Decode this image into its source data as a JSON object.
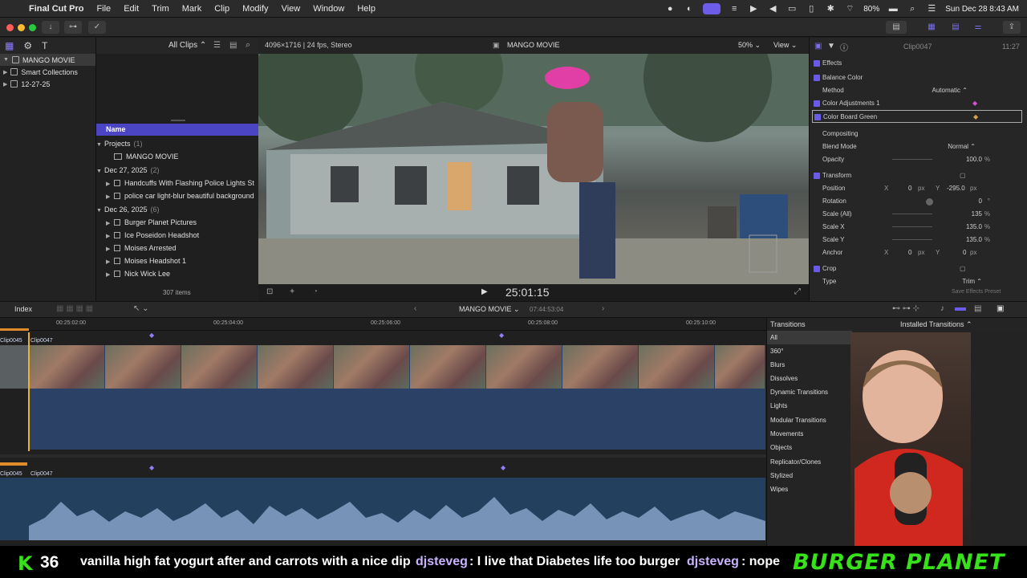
{
  "menubar": {
    "app_name": "Final Cut Pro",
    "items": [
      "File",
      "Edit",
      "Trim",
      "Mark",
      "Clip",
      "Modify",
      "View",
      "Window",
      "Help"
    ],
    "battery": "80%",
    "datetime": "Sun Dec 28  8:43 AM"
  },
  "browser": {
    "filter": "All Clips",
    "format": "4096×1716 | 24 fps, Stereo",
    "libraries": [
      {
        "label": "MANGO MOVIE"
      },
      {
        "label": "Smart Collections"
      },
      {
        "label": "12-27-25"
      }
    ],
    "column_name": "Name",
    "rows": [
      {
        "label": "Projects",
        "count": "(1)",
        "kind": "group"
      },
      {
        "label": "MANGO MOVIE",
        "kind": "project"
      },
      {
        "label": "Dec 27, 2025",
        "count": "(2)",
        "kind": "group"
      },
      {
        "label": "Handcuffs With Flashing Police Lights St",
        "kind": "clip"
      },
      {
        "label": "police car light-blur beautiful background",
        "kind": "clip"
      },
      {
        "label": "Dec 26, 2025",
        "count": "(6)",
        "kind": "group"
      },
      {
        "label": "Burger Planet Pictures",
        "kind": "clip"
      },
      {
        "label": "Ice Poseidon Headshot",
        "kind": "clip"
      },
      {
        "label": "Moises Arrested",
        "kind": "clip"
      },
      {
        "label": "Moises Headshot 1",
        "kind": "clip"
      },
      {
        "label": "Nick Wick Lee",
        "kind": "clip"
      }
    ],
    "item_count": "307 items"
  },
  "viewer": {
    "title": "MANGO MOVIE",
    "zoom": "50%",
    "view_label": "View",
    "timecode": "25:01:15"
  },
  "inspector": {
    "clip_name": "Clip0047",
    "duration": "11:27",
    "effects_label": "Effects",
    "balance_color": "Balance Color",
    "method_label": "Method",
    "method_value": "Automatic",
    "color_adj": "Color Adjustments 1",
    "color_board": "Color Board Green",
    "compositing": "Compositing",
    "blend_label": "Blend Mode",
    "blend_value": "Normal",
    "opacity_label": "Opacity",
    "opacity_value": "100.0",
    "percent": "%",
    "transform": "Transform",
    "position_label": "Position",
    "pos_x_label": "X",
    "pos_x": "0",
    "pos_y_label": "Y",
    "pos_y": "-295.0",
    "px": "px",
    "rotation_label": "Rotation",
    "rotation_value": "0",
    "degree": "°",
    "scale_all_label": "Scale (All)",
    "scale_all": "135",
    "scale_x_label": "Scale X",
    "scale_x": "135.0",
    "scale_y_label": "Scale Y",
    "scale_y": "135.0",
    "anchor_label": "Anchor",
    "anchor_x": "0",
    "anchor_y": "0",
    "crop": "Crop",
    "type_label": "Type",
    "type_value": "Trim",
    "save_preset": "Save Effects Preset"
  },
  "timeline": {
    "index_label": "Index",
    "project": "MANGO MOVIE",
    "duration": "07:44:53:04",
    "ticks": [
      "00:25:02:00",
      "00:25:04:00",
      "00:25:06:00",
      "00:25:08:00",
      "00:25:10:00"
    ],
    "clip_a": "Clip0045",
    "clip_b": "Clip0047",
    "audio_a": "Clip0045",
    "audio_b": "Clip0047"
  },
  "transitions": {
    "title": "Transitions",
    "installed": "Installed Transitions",
    "categories": [
      "All",
      "360°",
      "Blurs",
      "Dissolves",
      "Dynamic Transitions",
      "Lights",
      "Modular Transitions",
      "Movements",
      "Objects",
      "Replicator/Clones",
      "Stylized",
      "Wipes"
    ]
  },
  "ticker": {
    "count": "36",
    "msg1": "vanilla high fat yogurt after and carrots with a nice dip",
    "user1": "djsteveg",
    "msg2": ": I live that Diabetes life too burger",
    "user2": "djsteveg",
    "msg3": ": nope",
    "brand": "BURGER PLANET"
  },
  "colors": {
    "accent": "#6b5ce7",
    "clip_blue": "#2b4266",
    "audio_blue": "#24405f",
    "ticker_green": "#37e21a"
  }
}
